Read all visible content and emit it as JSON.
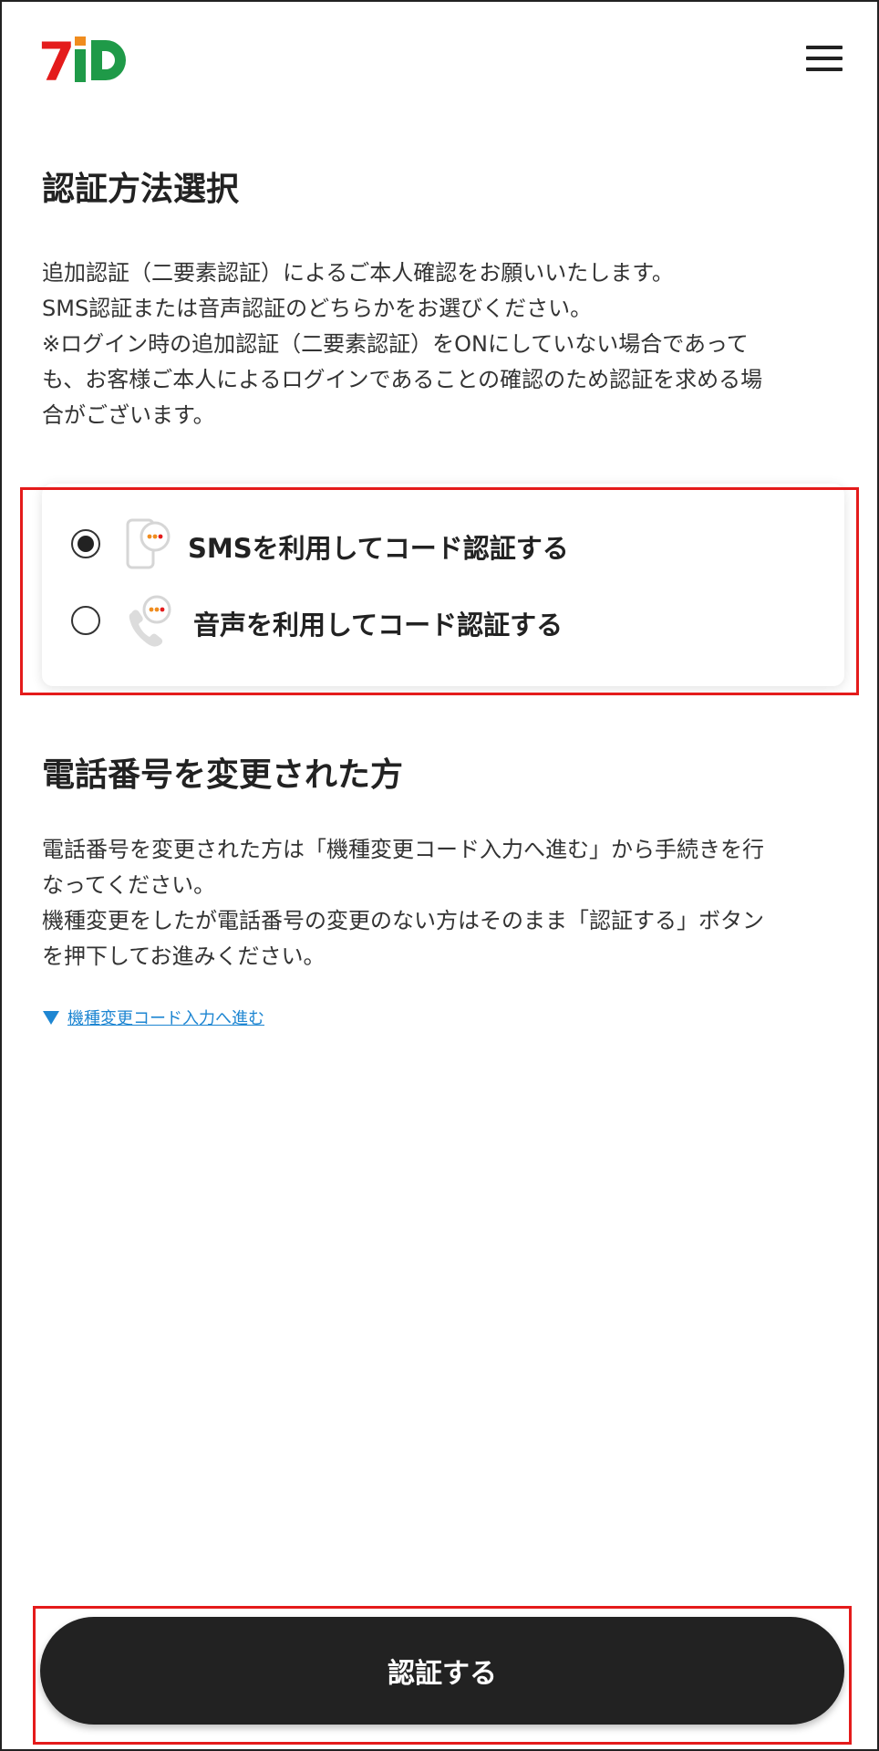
{
  "header": {
    "logo_text": "7iD",
    "logo_icon": "7id-logo",
    "menu_icon": "hamburger-menu-icon"
  },
  "section1": {
    "title": "認証方法選択",
    "paragraph_lines": [
      "追加認証（二要素認証）によるご本人確認をお願いいたします。",
      "SMS認証または音声認証のどちらかをお選びください。",
      "※ログイン時の追加認証（二要素認証）をONにしていない場合であって",
      "も、お客様ご本人によるログインであることの確認のため認証を求める場",
      "合がございます。"
    ]
  },
  "options": [
    {
      "label": "SMSを利用してコード認証する",
      "checked": true,
      "icon": "sms-phone-icon"
    },
    {
      "label": "音声を利用してコード認証する",
      "checked": false,
      "icon": "voice-call-icon"
    }
  ],
  "section2": {
    "title": "電話番号を変更された方",
    "paragraph_lines": [
      "電話番号を変更された方は「機種変更コード入力へ進む」から手続きを行",
      "なってください。",
      "機種変更をしたが電話番号の変更のない方はそのまま「認証する」ボタン",
      "を押下してお進みください。"
    ],
    "link_label": "機種変更コード入力へ進む",
    "link_icon": "triangle-down-icon"
  },
  "submit_label": "認証する",
  "colors": {
    "accent_red": "#e41b1b",
    "logo_green": "#1f9a48",
    "logo_orange": "#f08c1e",
    "link_blue": "#1e86d2",
    "button_dark": "#222222"
  }
}
